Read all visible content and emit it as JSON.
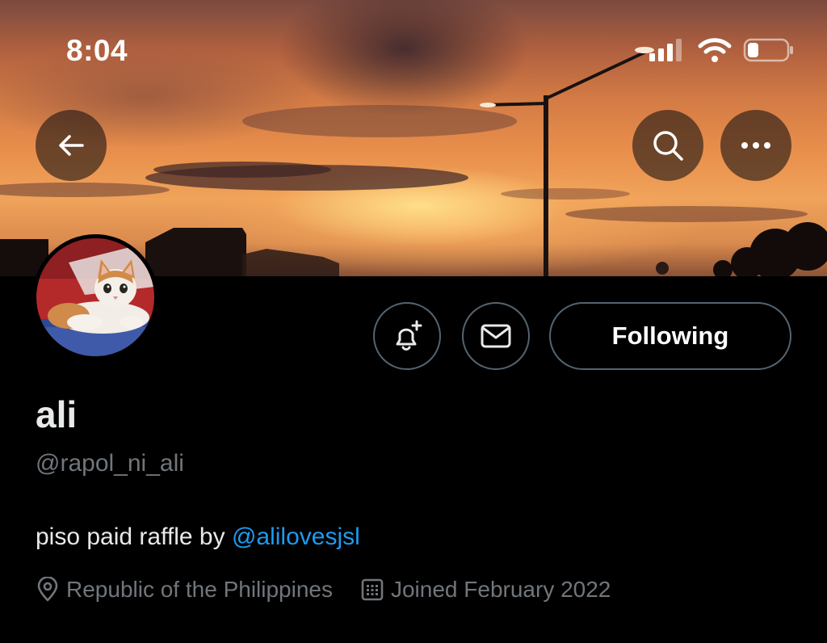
{
  "status_bar": {
    "time": "8:04"
  },
  "banner": {
    "back_icon": "arrow-left-icon",
    "search_icon": "search-icon",
    "more_icon": "more-horizontal-icon"
  },
  "profile": {
    "avatar": "cat-avatar",
    "name": "ali",
    "handle": "@rapol_ni_ali",
    "bio_text": "piso paid raffle by ",
    "bio_mention": "@alilovesjsl",
    "location": "Republic of the Philippines",
    "joined": "Joined February 2022"
  },
  "actions": {
    "notify_icon": "bell-plus-icon",
    "message_icon": "envelope-icon",
    "follow_label": "Following"
  },
  "colors": {
    "background": "#000000",
    "text": "#e7e9ea",
    "secondary_text": "#71767b",
    "mention": "#1d9bf0",
    "button_border": "#536471"
  }
}
